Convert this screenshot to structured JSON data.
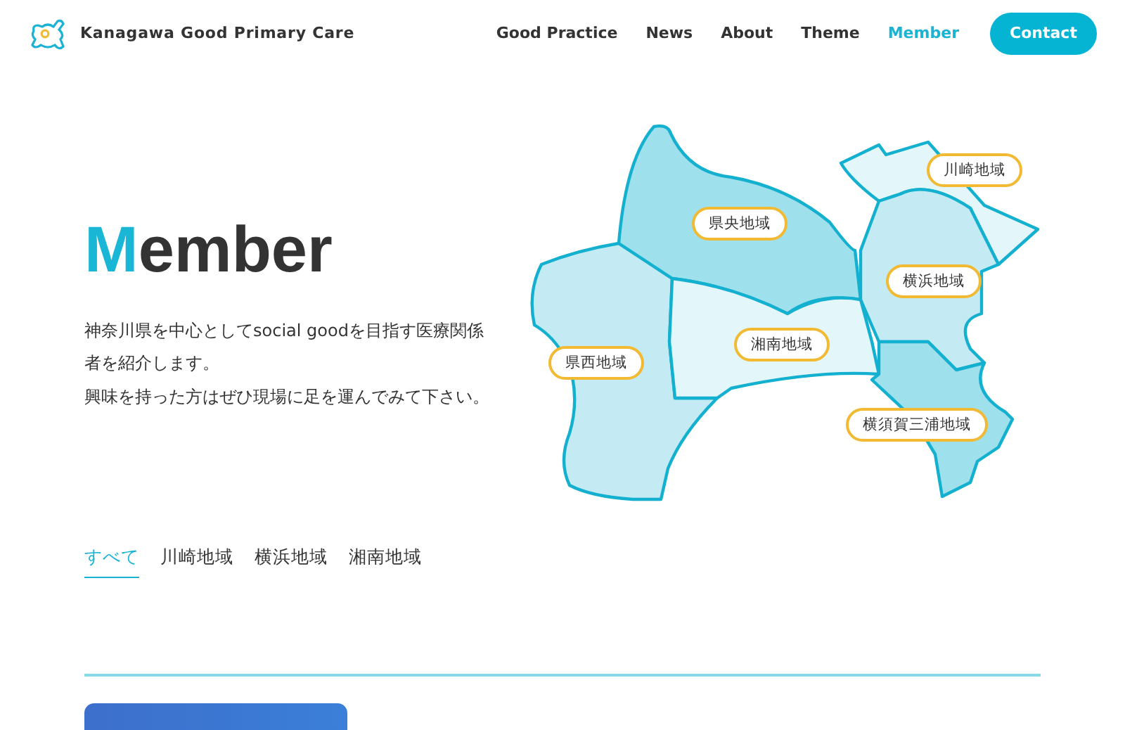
{
  "site": {
    "title": "Kanagawa Good Primary Care"
  },
  "nav": [
    {
      "label": "Good Practice",
      "selected": false
    },
    {
      "label": "News",
      "selected": false
    },
    {
      "label": "About",
      "selected": false
    },
    {
      "label": "Theme",
      "selected": false
    },
    {
      "label": "Member",
      "selected": true
    }
  ],
  "contact_button": "Contact",
  "hero": {
    "title_initial": "M",
    "title_rest": "ember",
    "description": [
      "神奈川県を中心としてsocial goodを目指す医療関係者を紹介します。",
      "興味を持った方はぜひ現場に足を運んでみて下さい。"
    ]
  },
  "map": {
    "regions": [
      {
        "label": "県西地域",
        "color": "#c4ebf3"
      },
      {
        "label": "県央地域",
        "color": "#9ee0ec"
      },
      {
        "label": "湘南地域",
        "color": "#e3f6fa"
      },
      {
        "label": "川崎地域",
        "color": "#e3f6fa"
      },
      {
        "label": "横浜地域",
        "color": "#c4ebf3"
      },
      {
        "label": "横須賀三浦地域",
        "color": "#9ee0ec"
      }
    ]
  },
  "filter_tabs": [
    {
      "label": "すべて",
      "selected": true
    },
    {
      "label": "川崎地域",
      "selected": false
    },
    {
      "label": "横浜地域",
      "selected": false
    },
    {
      "label": "湘南地域",
      "selected": false
    }
  ]
}
